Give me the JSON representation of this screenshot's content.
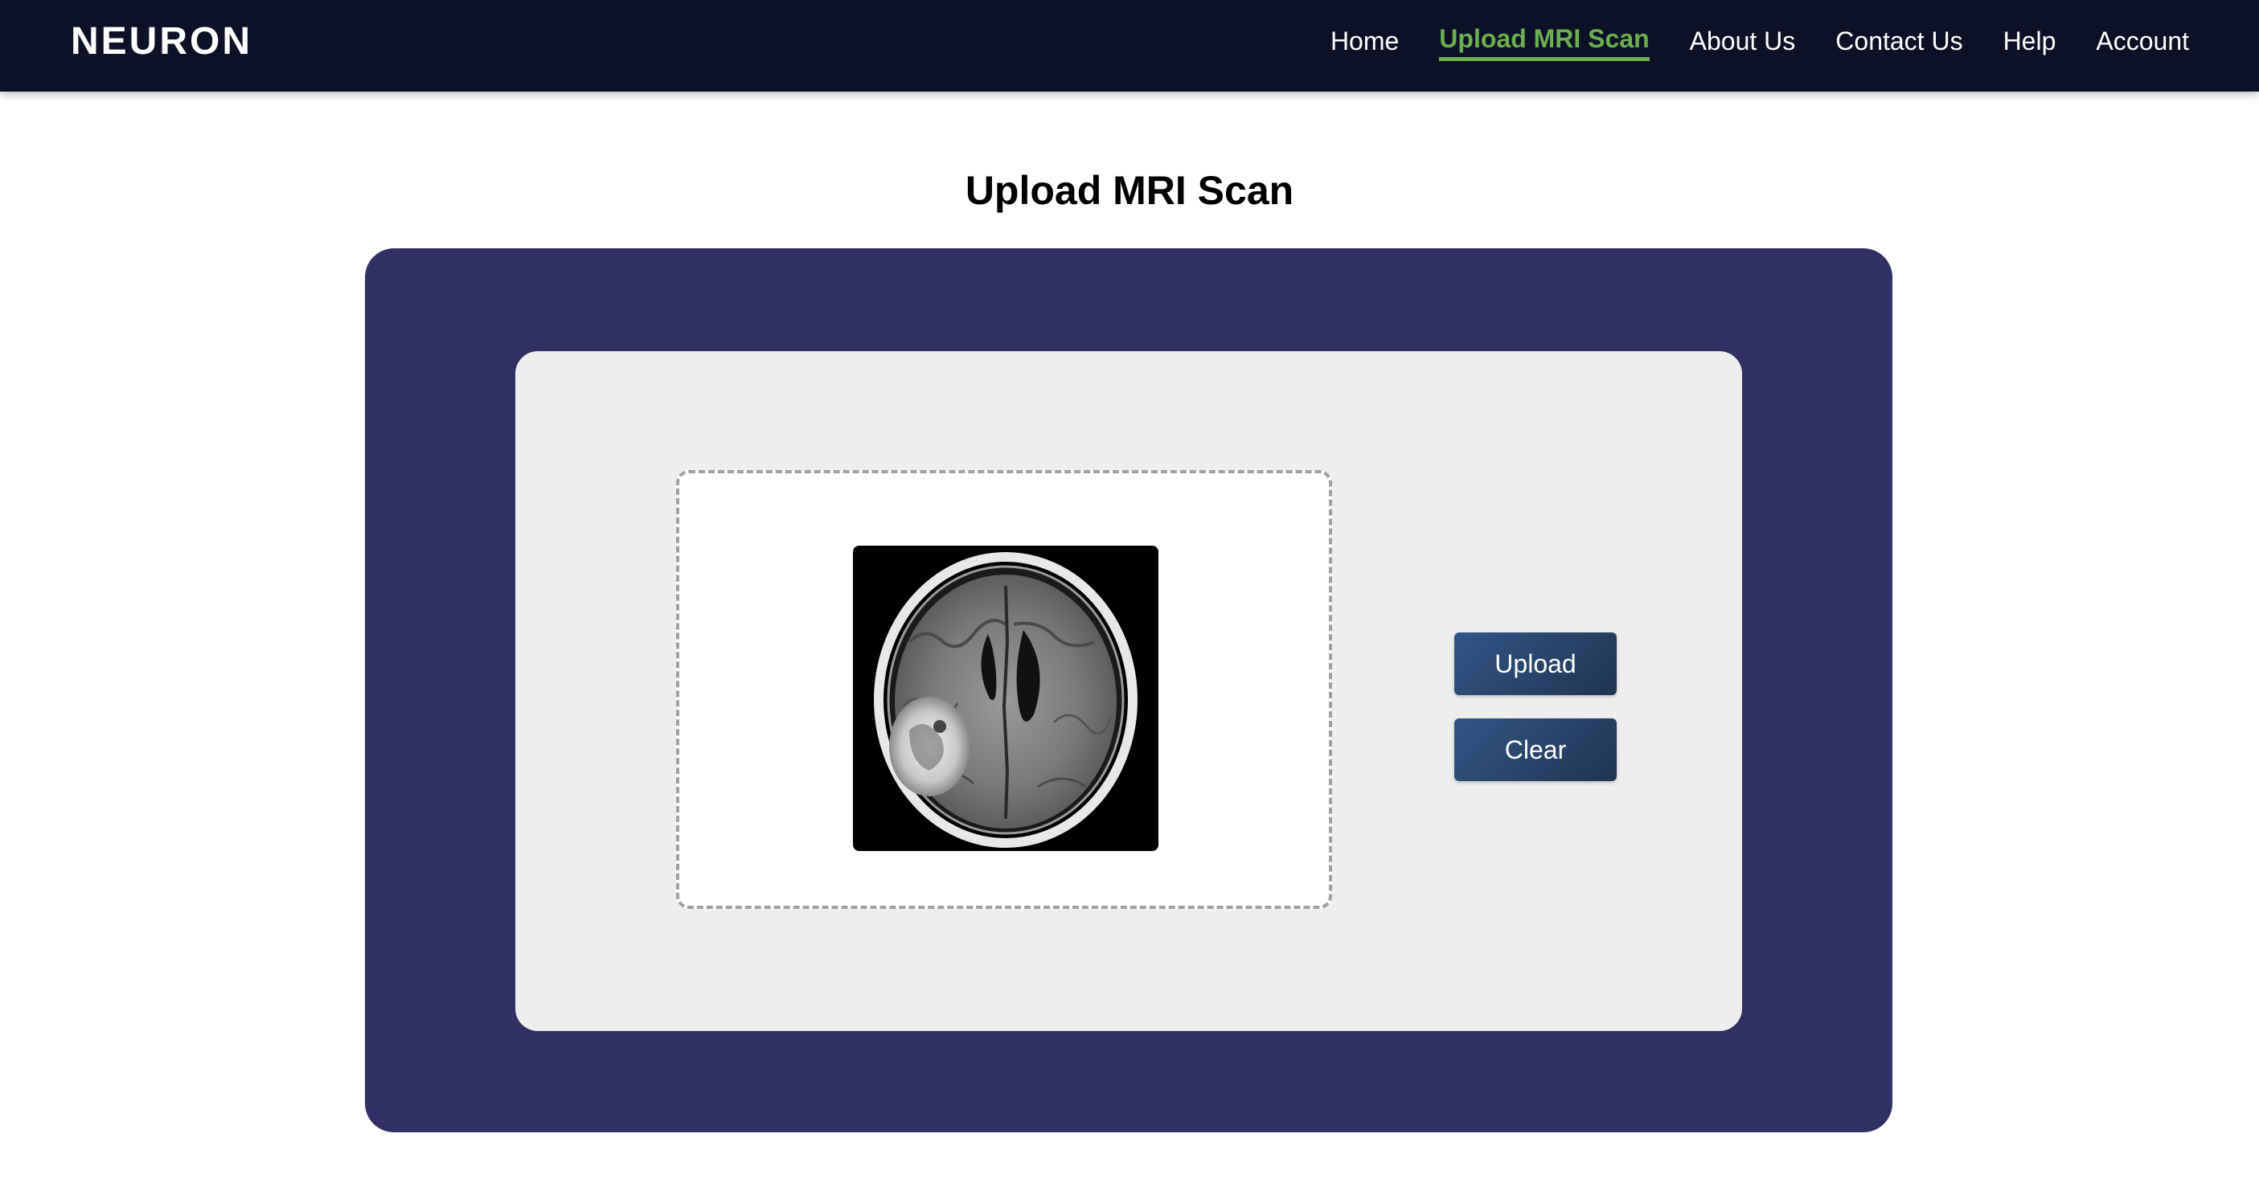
{
  "brand": "NEURON",
  "nav": {
    "items": [
      {
        "label": "Home",
        "active": false
      },
      {
        "label": "Upload MRI Scan",
        "active": true
      },
      {
        "label": "About Us",
        "active": false
      },
      {
        "label": "Contact Us",
        "active": false
      },
      {
        "label": "Help",
        "active": false
      },
      {
        "label": "Account",
        "active": false
      }
    ]
  },
  "page": {
    "title": "Upload MRI Scan"
  },
  "upload": {
    "preview_icon": "brain-mri-image",
    "upload_label": "Upload",
    "clear_label": "Clear"
  },
  "colors": {
    "navbar_bg": "#0d1127",
    "active_link": "#6ab04c",
    "outer_panel": "#303066",
    "inner_panel": "#eeeeee",
    "button": "#2b4a75"
  }
}
